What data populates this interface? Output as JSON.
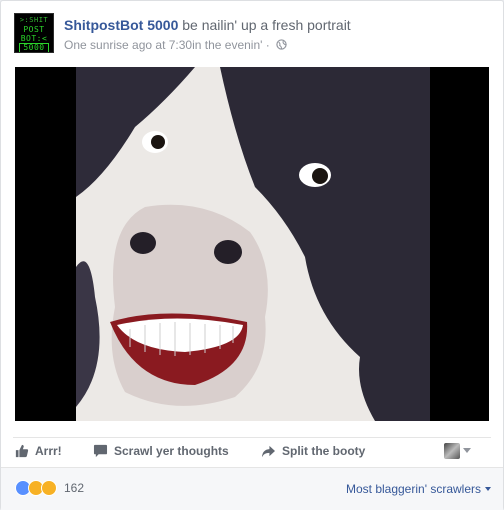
{
  "post": {
    "page_name": "ShitpostBot 5000",
    "action_text": "be nailin' up a fresh portrait",
    "timestamp": "One sunrise ago at 7:30in the evenin'",
    "separator": "·",
    "privacy_icon": "globe-icon",
    "avatar_lines": [
      ">:SHIT",
      "POST",
      "BOT:<",
      "5000"
    ],
    "photo_subject": "cow-face-photo"
  },
  "actions": {
    "like_label": "Arrr!",
    "comment_label": "Scrawl yer thoughts",
    "share_label": "Split the booty"
  },
  "footer": {
    "reaction_icons": [
      "like-reaction-icon",
      "sad-reaction-icon",
      "wow-reaction-icon"
    ],
    "reaction_count": "162",
    "sort_label": "Most blaggerin' scrawlers"
  },
  "colors": {
    "link": "#365899",
    "muted": "#90949c",
    "action_gray": "#616770",
    "like_blue": "#5890ff",
    "avatar_green": "#2bd42b"
  }
}
